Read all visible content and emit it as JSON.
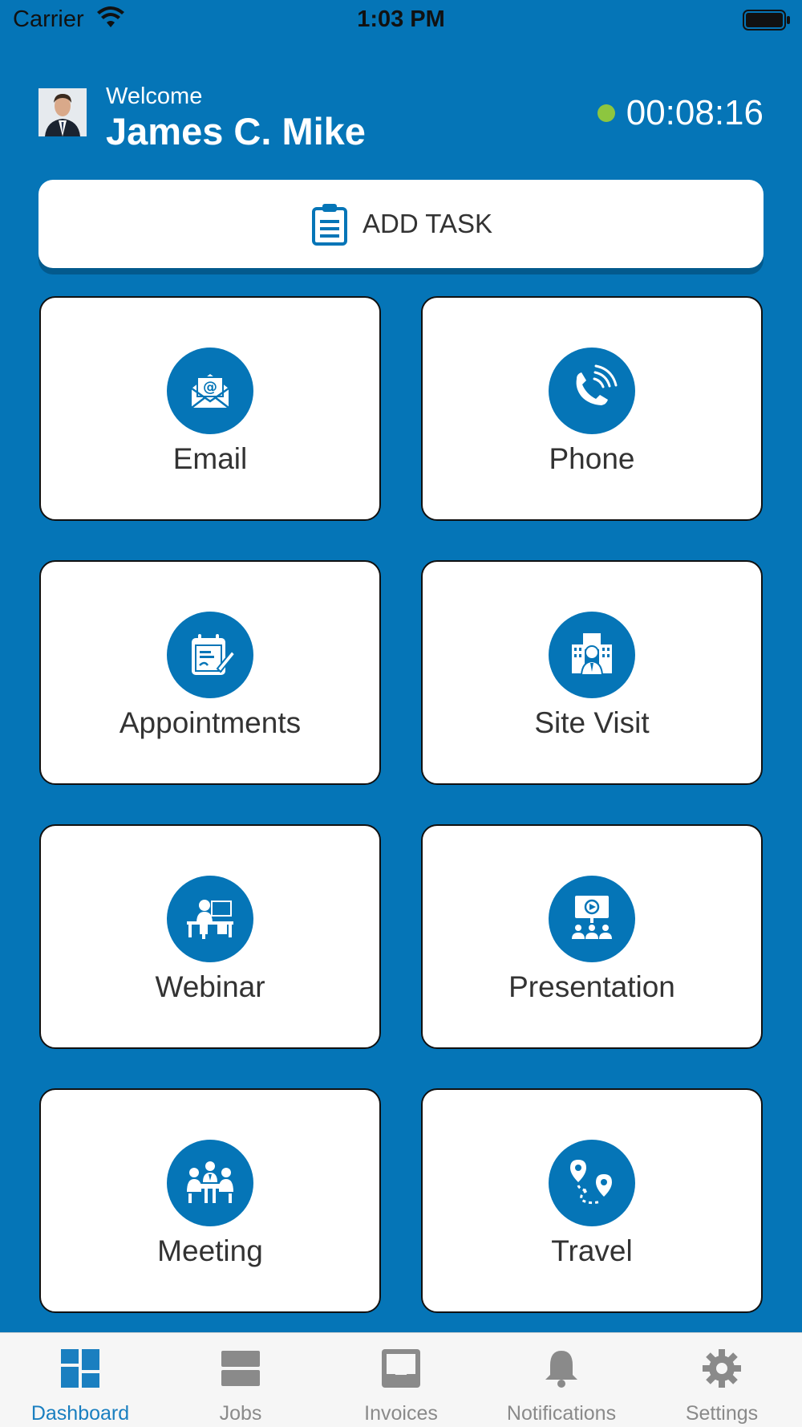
{
  "status_bar": {
    "carrier": "Carrier",
    "time": "1:03 PM"
  },
  "header": {
    "welcome": "Welcome",
    "name": "James C. Mike",
    "timer": "00:08:16",
    "status_color": "#8dc63f"
  },
  "add_task": {
    "label": "ADD TASK",
    "icon": "clipboard-icon"
  },
  "tiles": [
    {
      "label": "Email",
      "icon": "email-icon"
    },
    {
      "label": "Phone",
      "icon": "phone-icon"
    },
    {
      "label": "Appointments",
      "icon": "calendar-icon"
    },
    {
      "label": "Site Visit",
      "icon": "building-person-icon"
    },
    {
      "label": "Webinar",
      "icon": "desk-computer-icon"
    },
    {
      "label": "Presentation",
      "icon": "presentation-icon"
    },
    {
      "label": "Meeting",
      "icon": "meeting-icon"
    },
    {
      "label": "Travel",
      "icon": "map-route-icon"
    }
  ],
  "tab_bar": {
    "items": [
      {
        "label": "Dashboard",
        "icon": "dashboard-icon",
        "active": true
      },
      {
        "label": "Jobs",
        "icon": "jobs-icon",
        "active": false
      },
      {
        "label": "Invoices",
        "icon": "inbox-icon",
        "active": false
      },
      {
        "label": "Notifications",
        "icon": "bell-icon",
        "active": false
      },
      {
        "label": "Settings",
        "icon": "gear-icon",
        "active": false
      }
    ]
  },
  "colors": {
    "brand_blue": "#0575B7",
    "active_tab": "#1a7fc0",
    "inactive_tab": "#8a8a8a"
  }
}
